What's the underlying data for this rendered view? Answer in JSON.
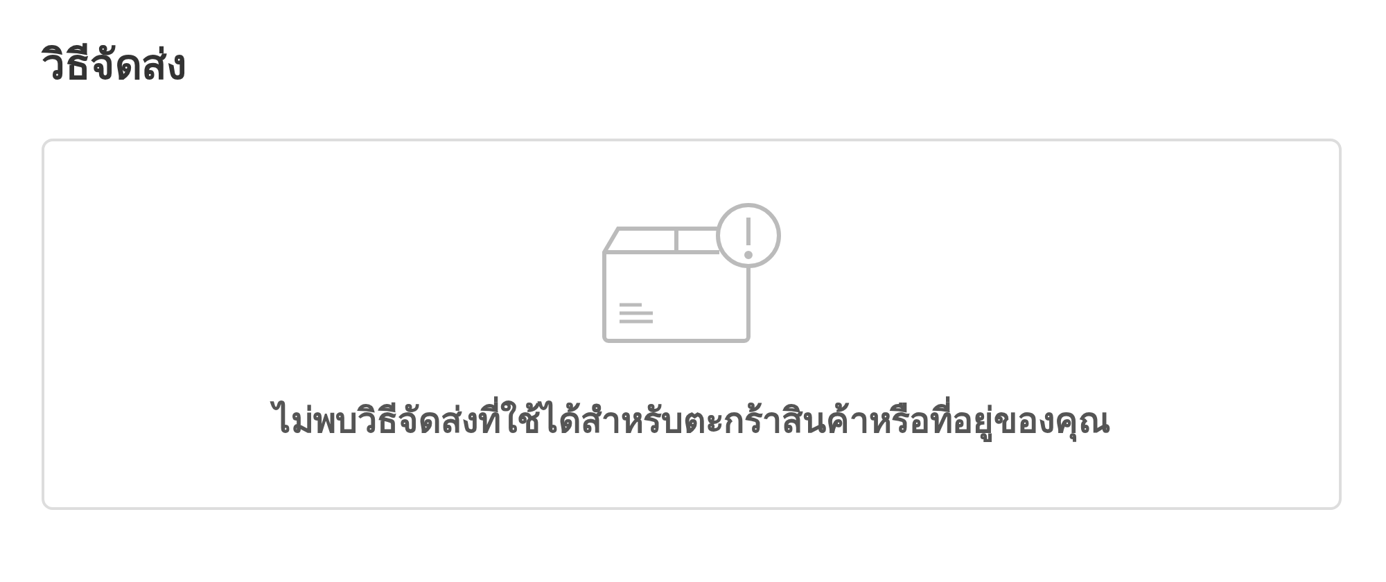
{
  "section": {
    "title": "วิธีจัดส่ง"
  },
  "empty_state": {
    "message": "ไม่พบวิธีจัดส่งที่ใช้ได้สำหรับตะกร้าสินค้าหรือที่อยู่ของคุณ"
  }
}
